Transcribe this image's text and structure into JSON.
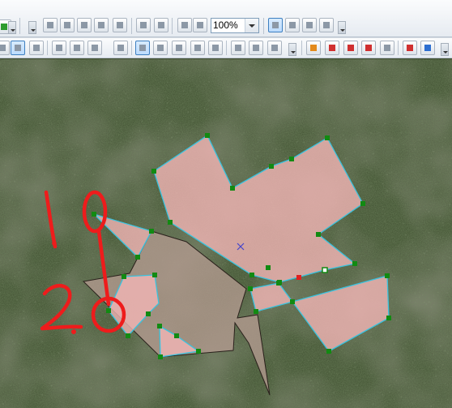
{
  "toolbar": {
    "zoom_value": "100%",
    "zoom_options": [
      "100%"
    ]
  },
  "map": {
    "annotations": [
      "1.",
      "2."
    ],
    "colors": {
      "polygon_fill": "#f2b5b5",
      "polygon_edge": "#39c3df",
      "vertex": "#128a12",
      "selected_vertex": "#e02020",
      "gray_polygon_fill": "#b29a8e",
      "handwriting": "#ee1c1c",
      "centroid": "#4444cc"
    }
  },
  "icons": {
    "select": "arrow-pointer-icon",
    "zoom_field": "zoom-combo",
    "snapping": "magnet-icon",
    "globe": "globe-icon"
  }
}
